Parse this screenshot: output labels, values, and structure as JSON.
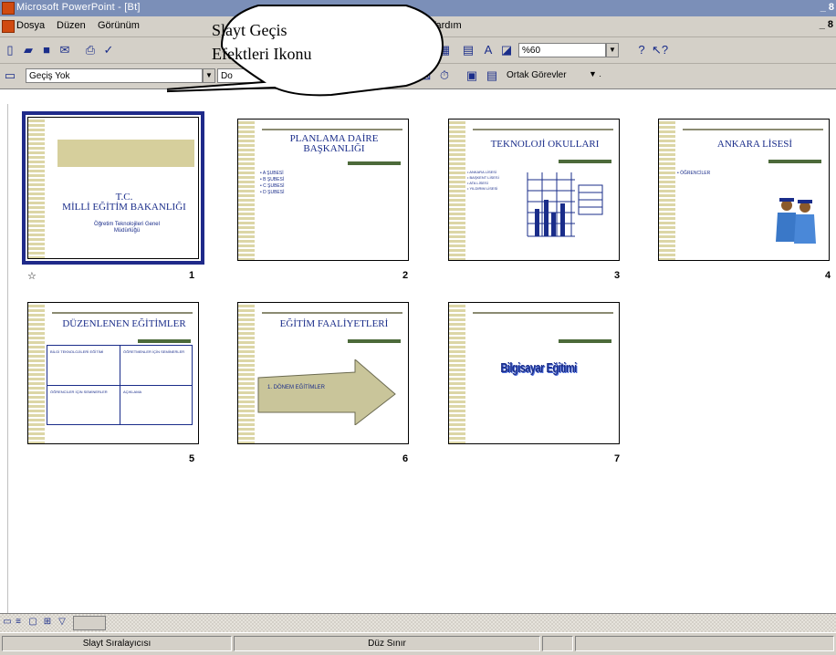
{
  "window": {
    "title": "Microsoft PowerPoint - [Bt]",
    "controls": "_ 8"
  },
  "menu": {
    "items": [
      "Dosya",
      "Düzen",
      "Görünüm",
      "Yardım"
    ],
    "controls": "_ 8"
  },
  "toolbar1": {
    "zoom": "%60",
    "icons": [
      "new-icon",
      "open-icon",
      "save-icon",
      "email-icon",
      "print-icon",
      "spelling-icon",
      "chart-icon",
      "table-icon",
      "columns-icon",
      "expand-icon",
      "grayscale-icon",
      "help-icon",
      "whats-this-icon"
    ]
  },
  "toolbar2": {
    "transition": "Geçiş Yok",
    "effect_value": "Do",
    "tasks": "Ortak Görevler"
  },
  "callout": {
    "line1": "Slayt Geçis",
    "line2": "Efektleri Ikonu"
  },
  "slides": [
    {
      "number": "1",
      "title_line1": "T.C.",
      "title_line2": "MİLLİ EĞİTİM BAKANLIĞI",
      "sub_line1": "Öğretim Teknolojileri Genel",
      "sub_line2": "Müdürlüğü",
      "marker": "☆"
    },
    {
      "number": "2",
      "title_line1": "PLANLAMA DAİRE",
      "title_line2": "BAŞKANLIĞI",
      "bullets": [
        "• A ŞUBESİ",
        "• B ŞUBESİ",
        "• C ŞUBESİ",
        "• D ŞUBESİ"
      ]
    },
    {
      "number": "3",
      "title_line1": "TEKNOLOJİ OKULLARI",
      "bullets": [
        "• ANKARA LİSESİ",
        "• BAŞKENT LİSESİ",
        "• ATA LİSESİ",
        "• YILDIRIM LİSESİ"
      ]
    },
    {
      "number": "4",
      "title_line1": "ANKARA LİSESİ",
      "bullets": [
        "• ÖĞRENCİLER"
      ]
    },
    {
      "number": "5",
      "title_line1": "DÜZENLENEN EĞİTİMLER",
      "cells": [
        "BİLGİ TEKNOLOJİLERİ EĞİTİMİ",
        "ÖĞRETMENLER İÇİN SEMİNERLER",
        "ÖĞRENCİLER İÇİN SEMİNERLER",
        "AÇIKLAMA"
      ]
    },
    {
      "number": "6",
      "title_line1": "EĞİTİM FAALİYETLERİ",
      "arrow_text": "1. DÖNEM EĞİTİMLER"
    },
    {
      "number": "7",
      "wordart": "Bilgisayar Eğitimi"
    }
  ],
  "status": {
    "view": "Slayt Sıralayıcısı",
    "design": "Düz Sınır"
  },
  "colors": {
    "accent": "#1f2a8a",
    "title_blue": "#1a2d8a",
    "title_bar_bg": "#7b8fb8",
    "chrome": "#d4d0c8",
    "stripe": "#dcd6a6",
    "green_bar": "#4c6a3a"
  }
}
